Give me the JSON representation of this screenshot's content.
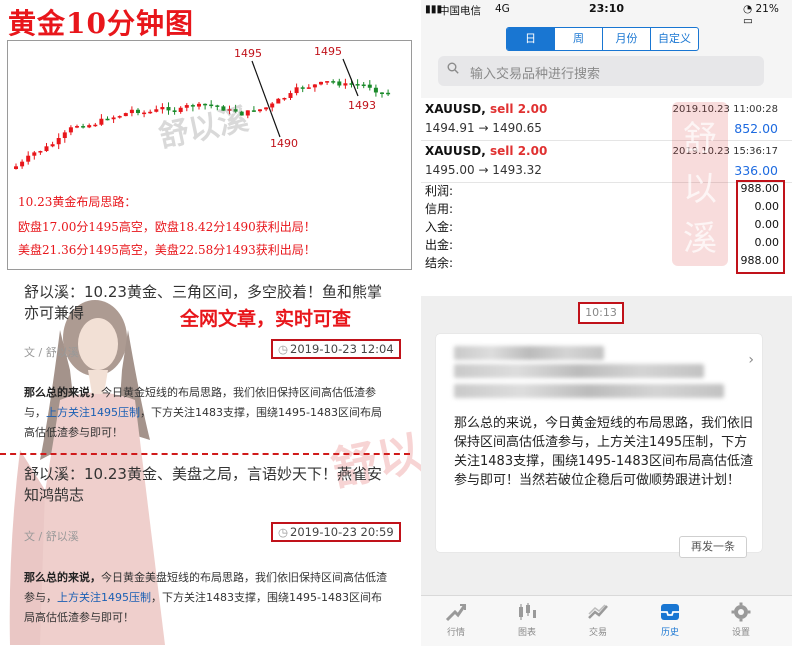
{
  "chart": {
    "title": "黄金10分钟图",
    "annotations": [
      "1495",
      "1490",
      "1495",
      "1493"
    ],
    "watermark": "舒以溪",
    "notes": [
      "10.23黄金布局思路：",
      "欧盘17.00分1495高空，欧盘18.42分1490获利出局！",
      "美盘21.36分1495高空，美盘22.58分1493获利出局！"
    ]
  },
  "chart_data": {
    "type": "candlestick",
    "annotations": [
      {
        "label": "1495"
      },
      {
        "label": "1490"
      },
      {
        "label": "1495"
      },
      {
        "label": "1493"
      }
    ],
    "colors": {
      "up": "#e8161b",
      "down": "#1a8a2a"
    }
  },
  "slogan": "全网文章，实时可查",
  "articles": [
    {
      "title": "舒以溪：10.23黄金、三角区间，多空胶着！鱼和熊掌亦可兼得",
      "meta": "文 / 舒以溪",
      "date": "2019-10-23 12:04",
      "body_bold": "那么总的来说，",
      "body_pre": "今日黄金短线的布局思路，我们依旧保持区间高估低渣参与，",
      "body_hl": "上方关注1495压制",
      "body_post": "，下方关注1483支撑，围绕1495-1483区间布局高估低渣参与即可！"
    },
    {
      "title": "舒以溪：10.23黄金、美盘之局，言语妙天下！燕雀安知鸿鹄志",
      "meta": "文 / 舒以溪",
      "date": "2019-10-23 20:59",
      "body_bold": "那么总的来说，",
      "body_pre": "今日黄金美盘短线的布局思路，我们依旧保持区间高估低渣参与，",
      "body_hl": "上方关注1495压制",
      "body_post": "，下方关注1483支撑，围绕1495-1483区间布局高估低渣参与即可！"
    }
  ],
  "phone": {
    "status": {
      "carrier": "中国电信",
      "network": "4G",
      "time": "23:10",
      "battery": "21%"
    },
    "segments": [
      "日",
      "周",
      "月份",
      "自定义"
    ],
    "active_segment": 0,
    "search_placeholder": "输入交易品种进行搜索",
    "trades": [
      {
        "symbol": "XAUUSD,",
        "side": "sell 2.00",
        "datetime": "2019.10.23 11:00:28",
        "prices": "1494.91 → 1490.65",
        "profit": "852.00"
      },
      {
        "symbol": "XAUUSD,",
        "side": "sell 2.00",
        "datetime": "2019.10.23 15:36:17",
        "prices": "1495.00 → 1493.32",
        "profit": "336.00"
      }
    ],
    "summary": [
      {
        "label": "利润:",
        "value": "988.00"
      },
      {
        "label": "信用:",
        "value": "0.00"
      },
      {
        "label": "入金:",
        "value": "0.00"
      },
      {
        "label": "出金:",
        "value": "0.00"
      },
      {
        "label": "结余:",
        "value": "988.00"
      }
    ]
  },
  "message": {
    "time": "10:13",
    "text": "那么总的来说，今日黄金短线的布局思路，我们依旧保持区间高估低渣参与，上方关注1495压制，下方关注1483支撑，围绕1495-1483区间布局高估低渣参与即可！当然若破位企稳后可做顺势跟进计划！",
    "resend": "再发一条"
  },
  "tabbar": [
    {
      "label": "行情",
      "icon": "quotes-icon"
    },
    {
      "label": "图表",
      "icon": "chart-icon"
    },
    {
      "label": "交易",
      "icon": "trade-icon"
    },
    {
      "label": "历史",
      "icon": "history-icon"
    },
    {
      "label": "设置",
      "icon": "settings-icon"
    }
  ],
  "active_tab": 3
}
